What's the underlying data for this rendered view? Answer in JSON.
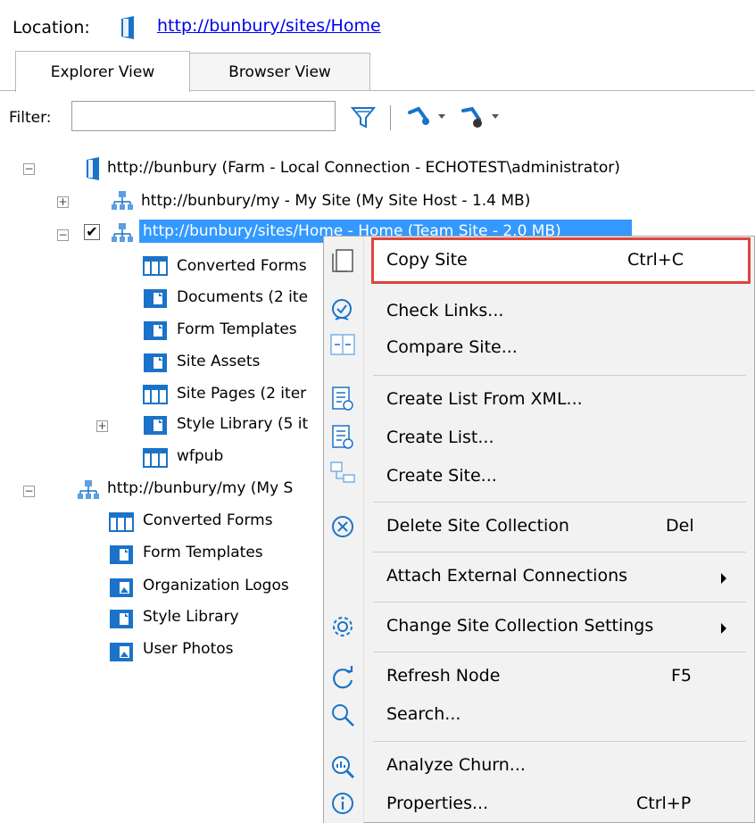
{
  "location": {
    "label": "Location:",
    "url": "http://bunbury/sites/Home"
  },
  "tabs": [
    {
      "label": "Explorer View"
    },
    {
      "label": "Browser View"
    }
  ],
  "filter": {
    "label": "Filter:",
    "value": ""
  },
  "tree": {
    "farm": "http://bunbury (Farm - Local Connection - ECHOTEST\\administrator)",
    "my_site": "http://bunbury/my - My Site (My Site Host - 1.4 MB)",
    "home_site": "http://bunbury/sites/Home - Home (Team Site - 2.0 MB)",
    "home_children": [
      "Converted Forms",
      "Documents (2 ite",
      "Form Templates",
      "Site Assets",
      "Site Pages (2 iter",
      "Style Library (5 it",
      "wfpub"
    ],
    "my_collection": "http://bunbury/my (My S",
    "my_children": [
      "Converted Forms",
      "Form Templates",
      "Organization Logos",
      "Style Library",
      "User Photos"
    ],
    "expanders": {
      "collapse": "−",
      "expand": "+",
      "check": "✔"
    }
  },
  "context_menu": {
    "items": [
      {
        "label": "Copy Site",
        "shortcut": "Ctrl+C",
        "icon": "copy-icon"
      },
      {
        "label": "Check Links...",
        "shortcut": "",
        "icon": "check-links-icon"
      },
      {
        "label": "Compare Site...",
        "shortcut": "",
        "icon": "compare-icon"
      },
      {
        "label": "Create List From XML...",
        "shortcut": "",
        "icon": "list-xml-icon"
      },
      {
        "label": "Create List...",
        "shortcut": "",
        "icon": "list-create-icon"
      },
      {
        "label": "Create Site...",
        "shortcut": "",
        "icon": "site-create-icon"
      },
      {
        "label": "Delete Site Collection",
        "shortcut": "Del",
        "icon": "delete-icon"
      },
      {
        "label": "Attach External Connections",
        "shortcut": "",
        "icon": ""
      },
      {
        "label": "Change Site Collection Settings",
        "shortcut": "",
        "icon": "gear-icon"
      },
      {
        "label": "Refresh Node",
        "shortcut": "F5",
        "icon": "refresh-icon"
      },
      {
        "label": "Search...",
        "shortcut": "",
        "icon": "search-icon"
      },
      {
        "label": "Analyze Churn...",
        "shortcut": "",
        "icon": "analyze-icon"
      },
      {
        "label": "Properties...",
        "shortcut": "Ctrl+P",
        "icon": "info-icon"
      }
    ]
  },
  "colors": {
    "accent": "#3399ff",
    "icon_blue": "#1a73c8",
    "highlight_border": "#e0443e",
    "link": "#0000ee"
  }
}
